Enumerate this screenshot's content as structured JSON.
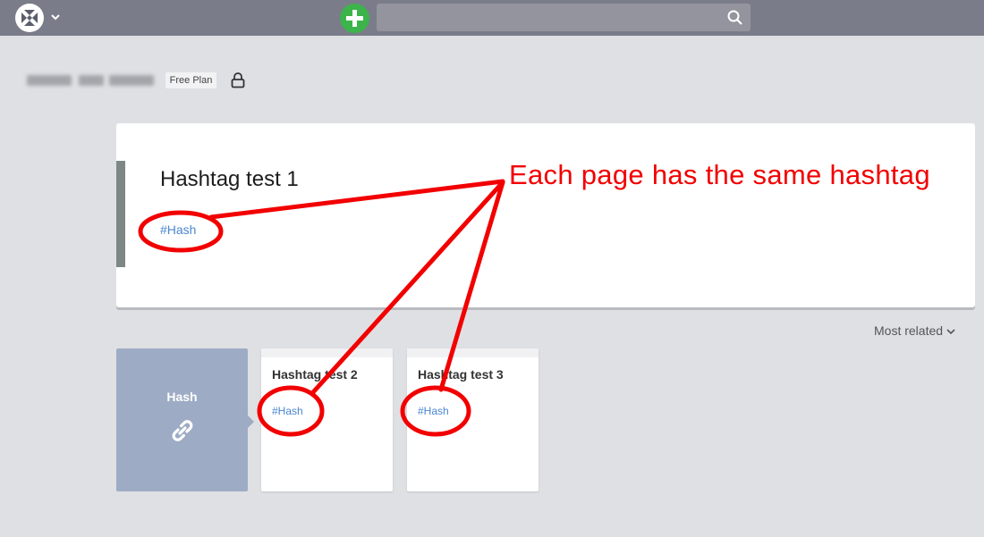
{
  "topbar": {
    "logo_icon": "app-logo-icon",
    "menu_icon": "chevron-down-icon",
    "add_icon": "plus-icon",
    "search": {
      "placeholder": "",
      "value": "",
      "icon": "search-icon"
    }
  },
  "user": {
    "plan_label": "Free Plan",
    "lock_icon": "lock-icon"
  },
  "main_page": {
    "title": "Hashtag test 1",
    "hashtag": "#Hash"
  },
  "sort": {
    "label": "Most related",
    "icon": "chevron-down-icon"
  },
  "hashtag_tile": {
    "label": "Hash",
    "icon": "link-icon"
  },
  "related_pages": [
    {
      "title": "Hashtag test 2",
      "hashtag": "#Hash"
    },
    {
      "title": "Hashtag test 3",
      "hashtag": "#Hash"
    }
  ],
  "annotation": {
    "text": "Each page has the same hashtag",
    "color": "#f20000"
  },
  "colors": {
    "topbar": "#7a7c89",
    "background": "#dfe0e4",
    "accent_green": "#3cb44b",
    "tag_blue": "#4a86d0",
    "tile": "#9eabc4"
  }
}
